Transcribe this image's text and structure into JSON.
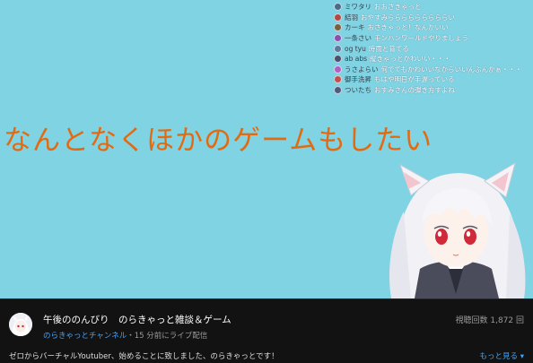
{
  "chat": [
    {
      "name": "ミワタリ",
      "message": "おおさきゃっと",
      "color": "#4a6b8a"
    },
    {
      "name": "結羽",
      "message": "おやすみらららららららららい",
      "color": "#b04a4a"
    },
    {
      "name": "カーキ",
      "message": "おさきゃっと！なんかいい",
      "color": "#7a6040"
    },
    {
      "name": "一条さい",
      "message": "モンハンワールドやりましょう",
      "color": "#8a50b0"
    },
    {
      "name": "og tyu",
      "message": "時雨と育てる",
      "color": "#5a7aa0"
    },
    {
      "name": "ab abs",
      "message": "縦きゃっとかわいい・・・",
      "color": "#4a5070"
    },
    {
      "name": "うさよらい",
      "message": "何でてもかわいいなからいいんぶんかぁ・・・",
      "color": "#b060c0"
    },
    {
      "name": "御手洗昇",
      "message": "もはや明日が手遅っている",
      "color": "#c05050"
    },
    {
      "name": "ついたち",
      "message": "おすみさんの弾き方すよね",
      "color": "#505a80"
    }
  ],
  "headline": "なんとなくほかのゲームもしたい",
  "video": {
    "title": "午後ののんびり　のらきゃっと雑談＆ゲーム",
    "views": "視聴回数 1,872 回",
    "channel": "のらきゃっとチャンネル",
    "live_when": "・15 分前にライブ配信",
    "description": "ゼロからバーチャルYoutuber、始めることに致しました、のらきゃっとです！",
    "more": "もっと見る ▾"
  },
  "colors": {
    "stream_bg": "#7fd3e3",
    "headline": "#e36a10",
    "link": "#3ea6ff",
    "page_bg": "#121212"
  }
}
